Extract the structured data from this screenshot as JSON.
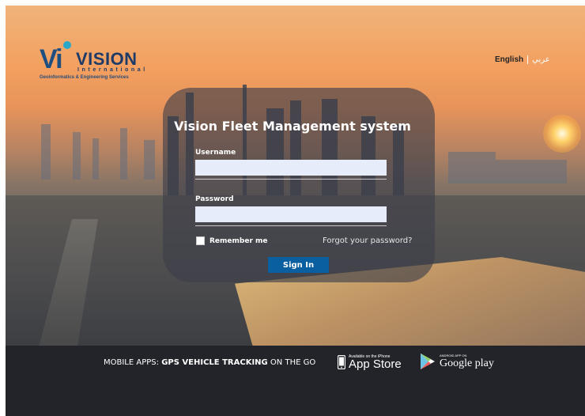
{
  "brand": {
    "logo_letters": "Vi",
    "name": "VISION",
    "subtitle": "International",
    "tagline": "Geoinformatics & Engineering Services"
  },
  "lang": {
    "english": "English",
    "arabic": "عربي"
  },
  "login": {
    "title": "Vision Fleet Management system",
    "username_label": "Username",
    "username_value": "",
    "password_label": "Password",
    "password_value": "",
    "remember_label": "Remember me",
    "remember_checked": false,
    "forgot_label": "Forgot your password?",
    "signin_label": "Sign In"
  },
  "footer": {
    "text_prefix": "MOBILE APPS: ",
    "text_bold": "GPS VEHICLE TRACKING",
    "text_suffix": " ON THE GO",
    "appstore_small": "Available on the iPhone",
    "appstore_big": "App Store",
    "gplay_small": "ANDROID APP ON",
    "gplay_big": "Google play"
  },
  "colors": {
    "signin": "#0a5fa0",
    "footer_bg": "#23242a",
    "field_bg": "#e6ecf9"
  }
}
